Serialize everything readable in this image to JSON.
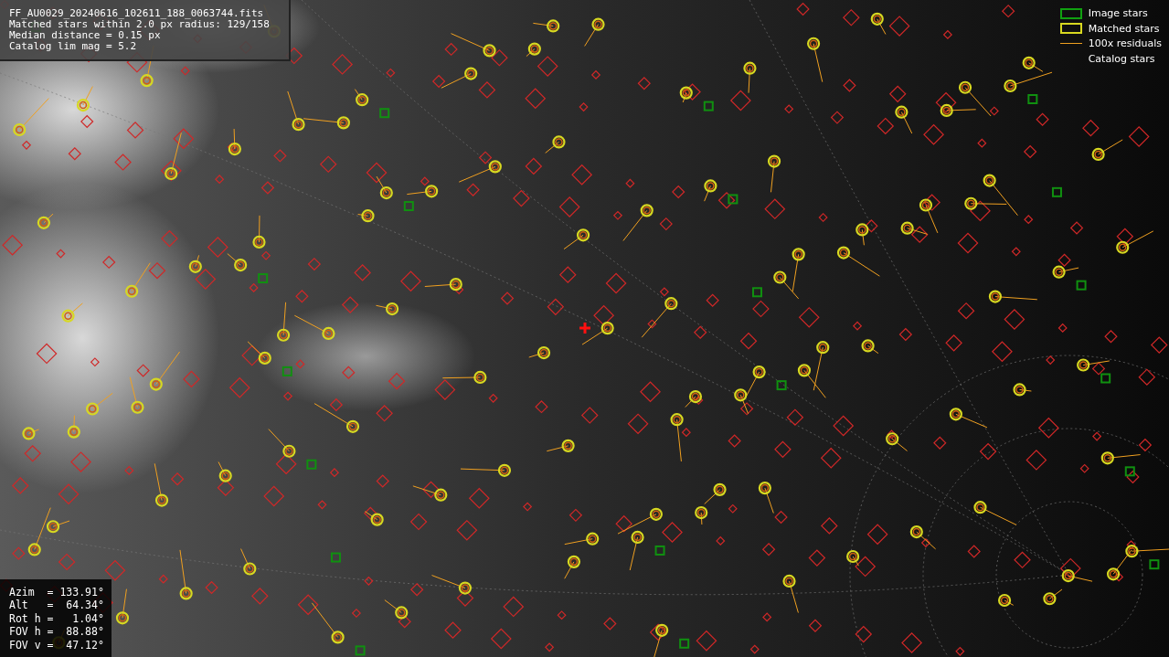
{
  "info_panel": {
    "lines": [
      "FF_AU0029_20240616_102611_188_0063744.fits",
      "Matched stars within 2.0 px radius: 129/158",
      "Median distance = 0.15 px",
      "Catalog lim mag = 5.2"
    ]
  },
  "legend": [
    {
      "kind": "image",
      "label": "Image stars"
    },
    {
      "kind": "matched",
      "label": "Matched stars"
    },
    {
      "kind": "residual",
      "label": "100x residuals"
    },
    {
      "kind": "catalog",
      "label": "Catalog stars"
    }
  ],
  "pointing_panel": {
    "lines": [
      "Azim  = 133.91°",
      "Alt   =  64.34°",
      "Rot h =   1.04°",
      "FOV h =  88.88°",
      "FOV v =  47.12°"
    ]
  }
}
